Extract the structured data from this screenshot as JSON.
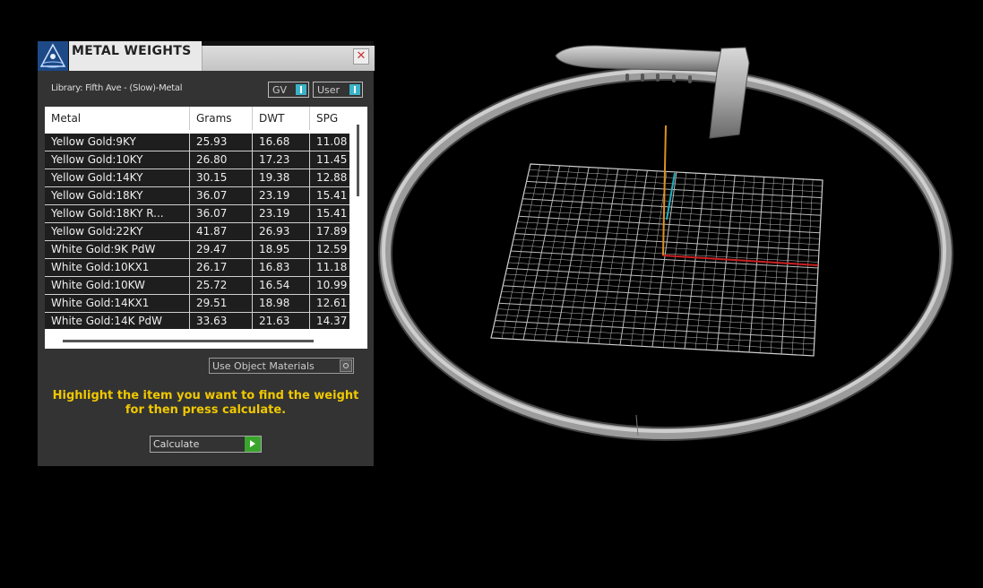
{
  "panel": {
    "title": "METAL WEIGHTS",
    "close_icon": "close-icon",
    "library_label": "Library: Fifth Ave - (Slow)-Metal",
    "toggle_gv": "GV",
    "toggle_user": "User",
    "dropdown_label": "Use Object Materials",
    "hint": "Highlight the item you want to find the weight for then press calculate.",
    "calculate_label": "Calculate"
  },
  "table": {
    "headers": [
      "Metal",
      "Grams",
      "DWT",
      "SPG"
    ],
    "rows": [
      [
        "Yellow Gold:9KY",
        "25.93",
        "16.68",
        "11.08"
      ],
      [
        "Yellow Gold:10KY",
        "26.80",
        "17.23",
        "11.45"
      ],
      [
        "Yellow Gold:14KY",
        "30.15",
        "19.38",
        "12.88"
      ],
      [
        "Yellow Gold:18KY",
        "36.07",
        "23.19",
        "15.41"
      ],
      [
        "Yellow Gold:18KY R...",
        "36.07",
        "23.19",
        "15.41"
      ],
      [
        "Yellow Gold:22KY",
        "41.87",
        "26.93",
        "17.89"
      ],
      [
        "White Gold:9K PdW",
        "29.47",
        "18.95",
        "12.59"
      ],
      [
        "White Gold:10KX1",
        "26.17",
        "16.83",
        "11.18"
      ],
      [
        "White Gold:10KW",
        "25.72",
        "16.54",
        "10.99"
      ],
      [
        "White Gold:14KX1",
        "29.51",
        "18.98",
        "12.61"
      ],
      [
        "White Gold:14K PdW",
        "33.63",
        "21.63",
        "14.37"
      ]
    ]
  },
  "colors": {
    "accent_yellow": "#f0c800",
    "toggle_cyan": "#3ab3c8",
    "play_green": "#3aa52c",
    "axis_x": "#cc2020",
    "axis_y": "#e09020",
    "axis_z": "#20b0c0"
  }
}
